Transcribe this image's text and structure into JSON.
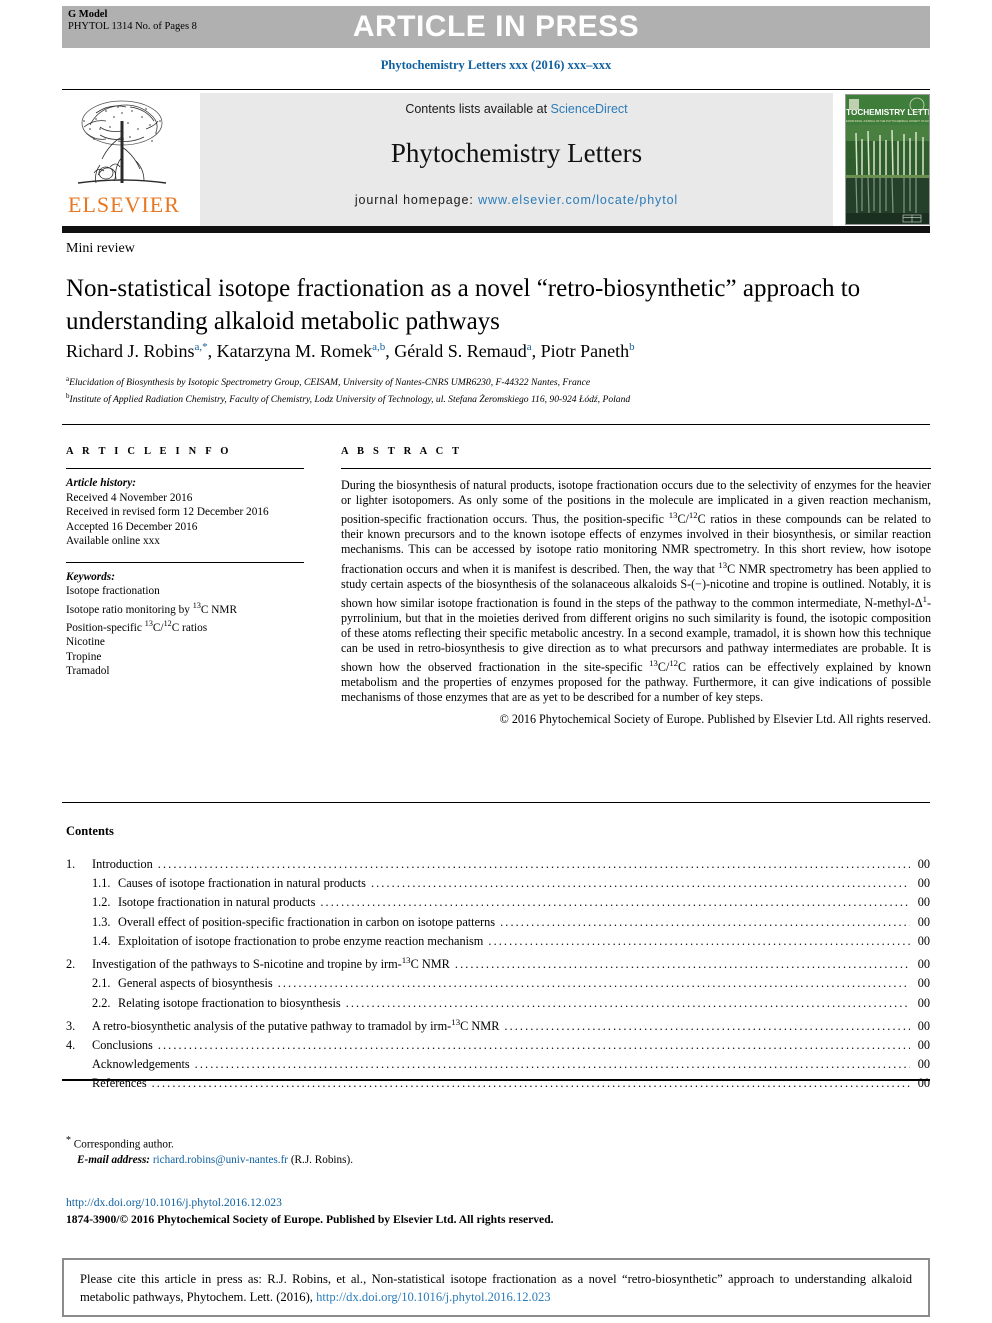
{
  "header": {
    "g_model_line1": "G Model",
    "g_model_line2": "PHYTOL 1314 No. of Pages 8",
    "article_in_press": "ARTICLE IN PRESS",
    "journal_running_head": "Phytochemistry Letters xxx (2016) xxx–xxx"
  },
  "masthead": {
    "contents_prefix": "Contents lists available at ",
    "sciencedirect": "ScienceDirect",
    "journal_name": "Phytochemistry Letters",
    "homepage_label": "journal homepage: ",
    "homepage_url": "www.elsevier.com/locate/phytol",
    "publisher_logo_text": "ELSEVIER",
    "cover_title": "PHYTOCHEMISTRY LETTERS",
    "cover_subtitle": "AN INTERNATIONAL JOURNAL OF THE PHYTOCHEMICAL SOCIETY OF EUROPE"
  },
  "article": {
    "section_type": "Mini review",
    "title": "Non-statistical isotope fractionation as a novel “retro-biosynthetic” approach to understanding alkaloid metabolic pathways",
    "authors": [
      {
        "name": "Richard J. Robins",
        "affil": "a,",
        "corresponding": "*"
      },
      {
        "name": "Katarzyna M. Romek",
        "affil": "a,b"
      },
      {
        "name": "Gérald S. Remaud",
        "affil": "a"
      },
      {
        "name": "Piotr Paneth",
        "affil": "b"
      }
    ],
    "affiliations": [
      {
        "marker": "a",
        "text": "Elucidation of Biosynthesis by Isotopic Spectrometry Group, CEISAM, University of Nantes-CNRS UMR6230, F-44322 Nantes, France"
      },
      {
        "marker": "b",
        "text": "Institute of Applied Radiation Chemistry, Faculty of Chemistry, Lodz University of Technology, ul. Stefana Żeromskiego 116, 90-924 Łódź, Poland"
      }
    ]
  },
  "info": {
    "heading": "A R T I C L E   I N F O",
    "history_label": "Article history:",
    "history": [
      "Received 4 November 2016",
      "Received in revised form 12 December 2016",
      "Accepted 16 December 2016",
      "Available online xxx"
    ],
    "keywords_label": "Keywords:",
    "keywords": [
      "Isotope fractionation",
      "Isotope ratio monitoring by 13C NMR",
      "Position-specific 13C/12C ratios",
      "Nicotine",
      "Tropine",
      "Tramadol"
    ]
  },
  "abstract": {
    "heading": "A B S T R A C T",
    "text": "During the biosynthesis of natural products, isotope fractionation occurs due to the selectivity of enzymes for the heavier or lighter isotopomers. As only some of the positions in the molecule are implicated in a given reaction mechanism, position-specific fractionation occurs. Thus, the position-specific 13C/12C ratios in these compounds can be related to their known precursors and to the known isotope effects of enzymes involved in their biosynthesis, or similar reaction mechanisms. This can be accessed by isotope ratio monitoring NMR spectrometry. In this short review, how isotope fractionation occurs and when it is manifest is described. Then, the way that 13C NMR spectrometry has been applied to study certain aspects of the biosynthesis of the solanaceous alkaloids S-(−)-nicotine and tropine is outlined. Notably, it is shown how similar isotope fractionation is found in the steps of the pathway to the common intermediate, N-methyl-Δ1-pyrrolinium, but that in the moieties derived from different origins no such similarity is found, the isotopic composition of these atoms reflecting their specific metabolic ancestry. In a second example, tramadol, it is shown how this technique can be used in retro-biosynthesis to give direction as to what precursors and pathway intermediates are probable. It is shown how the observed fractionation in the site-specific 13C/12C ratios can be effectively explained by known metabolism and the properties of enzymes proposed for the pathway. Furthermore, it can give indications of possible mechanisms of those enzymes that are as yet to be described for a number of key steps.",
    "copyright": "© 2016 Phytochemical Society of Europe. Published by Elsevier Ltd. All rights reserved."
  },
  "contents": {
    "heading": "Contents",
    "entries": [
      {
        "num": "1.",
        "indent": 0,
        "label": "Introduction",
        "page": "00"
      },
      {
        "num": "1.1.",
        "indent": 1,
        "label": "Causes of isotope fractionation in natural products",
        "page": "00"
      },
      {
        "num": "1.2.",
        "indent": 1,
        "label": "Isotope fractionation in natural products",
        "page": "00"
      },
      {
        "num": "1.3.",
        "indent": 1,
        "label": "Overall effect of position-specific fractionation in carbon on isotope patterns",
        "page": "00"
      },
      {
        "num": "1.4.",
        "indent": 1,
        "label": "Exploitation of isotope fractionation to probe enzyme reaction mechanism",
        "page": "00"
      },
      {
        "num": "2.",
        "indent": 0,
        "label": "Investigation of the pathways to S-nicotine and tropine by irm-13C NMR",
        "page": "00"
      },
      {
        "num": "2.1.",
        "indent": 1,
        "label": "General aspects of biosynthesis",
        "page": "00"
      },
      {
        "num": "2.2.",
        "indent": 1,
        "label": "Relating isotope fractionation to biosynthesis",
        "page": "00"
      },
      {
        "num": "3.",
        "indent": 0,
        "label": "A retro-biosynthetic analysis of the putative pathway to tramadol by irm-13C NMR",
        "page": "00"
      },
      {
        "num": "4.",
        "indent": 0,
        "label": "Conclusions",
        "page": "00"
      },
      {
        "num": "",
        "indent": 0,
        "label": "Acknowledgements",
        "page": "00"
      },
      {
        "num": "",
        "indent": 0,
        "label": "References",
        "page": "00"
      }
    ]
  },
  "footnotes": {
    "corresponding_author": "Corresponding author.",
    "email_label": "E-mail address:",
    "email": "richard.robins@univ-nantes.fr",
    "email_owner": "(R.J. Robins).",
    "doi": "http://dx.doi.org/10.1016/j.phytol.2016.12.023",
    "issn_line": "1874-3900/© 2016 Phytochemical Society of Europe. Published by Elsevier Ltd. All rights reserved."
  },
  "citation": {
    "text_part1": "Please cite this article in press as: R.J. Robins, et al., Non-statistical isotope fractionation as a novel “retro-biosynthetic” approach to understanding alkaloid metabolic pathways, Phytochem. Lett. (2016), ",
    "link": "http://dx.doi.org/10.1016/j.phytol.2016.12.023"
  },
  "colors": {
    "banner_gray": "#b0b0b0",
    "link_blue": "#2b7bb9",
    "heading_blue": "#1060a0",
    "elsevier_orange": "#E87722",
    "masthead_gray": "#e9e9e9",
    "cover_green": "#3f7d3a"
  }
}
